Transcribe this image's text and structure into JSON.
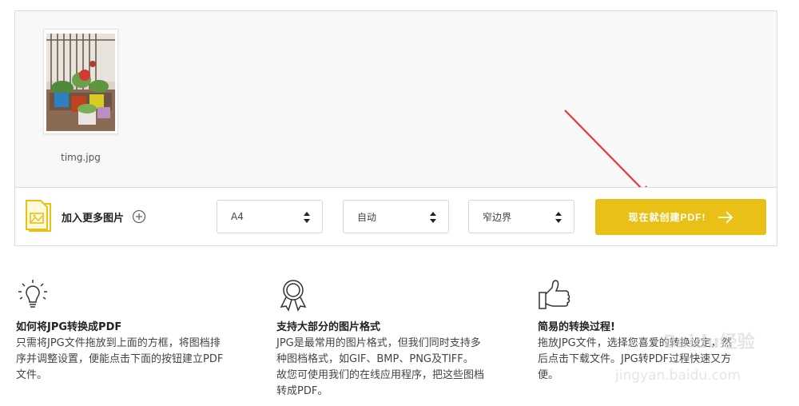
{
  "upload": {
    "file_name": "timg.jpg"
  },
  "toolbar": {
    "add_more_label": "加入更多图片",
    "page_size": "A4",
    "orientation": "自动",
    "margin": "窄边界",
    "create_label": "现在就创建PDF!"
  },
  "features": [
    {
      "icon": "lightbulb-icon",
      "title": "如何将JPG转换成PDF",
      "desc": "只需将JPG文件拖放到上面的方框，将图档排\n序并调整设置，便能点击下面的按钮建立PDF\n文件。"
    },
    {
      "icon": "award-ribbon-icon",
      "title": "支持大部分的图片格式",
      "desc": "JPG是最常用的图片格式，但我们同时支持多\n种图档格式，如GIF、BMP、PNG及TIFF。\n故您可使用我们的在线应用程序，把这些图档\n转成PDF。"
    },
    {
      "icon": "thumbs-up-icon",
      "title": "简易的转换过程!",
      "desc": "拖放JPG文件，选择您喜爱的转换设定，然\n后点击下载文件。JPG转PDF过程快速又方\n便。"
    }
  ],
  "watermark": {
    "main": "Baidu经验",
    "sub": "jingyan.baidu.com"
  },
  "colors": {
    "accent": "#e8c016",
    "annotation": "#e53935"
  }
}
